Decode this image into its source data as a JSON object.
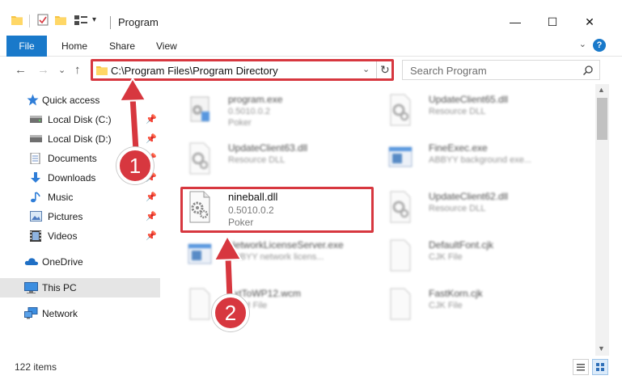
{
  "window": {
    "title": "Program",
    "minimize_glyph": "—",
    "maximize_glyph": "☐",
    "close_glyph": "✕"
  },
  "ribbon": {
    "file": "File",
    "tabs": [
      "Home",
      "Share",
      "View"
    ],
    "expand_glyph": "⌄",
    "help_glyph": "?"
  },
  "navigation": {
    "back_glyph": "←",
    "forward_glyph": "→",
    "recent_glyph": "⌄",
    "up_glyph": "↑",
    "address": "C:\\Program Files\\Program Directory",
    "address_dropdown_glyph": "⌄",
    "refresh_glyph": "↻",
    "search_placeholder": "Search Program"
  },
  "sidebar": {
    "items": [
      {
        "label": "Quick access",
        "icon": "star-icon",
        "pinned": false
      },
      {
        "label": "Local Disk (C:)",
        "icon": "drive-icon",
        "pinned": true
      },
      {
        "label": "Local Disk (D:)",
        "icon": "drive-icon",
        "pinned": true
      },
      {
        "label": "Documents",
        "icon": "documents-icon",
        "pinned": true
      },
      {
        "label": "Downloads",
        "icon": "download-icon",
        "pinned": true
      },
      {
        "label": "Music",
        "icon": "music-icon",
        "pinned": true
      },
      {
        "label": "Pictures",
        "icon": "pictures-icon",
        "pinned": true
      },
      {
        "label": "Videos",
        "icon": "videos-icon",
        "pinned": true
      },
      {
        "label": "OneDrive",
        "icon": "cloud-icon",
        "pinned": false
      },
      {
        "label": "This PC",
        "icon": "computer-icon",
        "pinned": false,
        "selected": true
      },
      {
        "label": "Network",
        "icon": "network-icon",
        "pinned": false
      }
    ],
    "pin_glyph": "📌"
  },
  "files": [
    {
      "name": "program.exe",
      "sub1": "0.5010.0.2",
      "sub2": "Poker",
      "icon": "exe-gear-icon"
    },
    {
      "name": "UpdateClient65.dll",
      "sub1": "Resource DLL",
      "sub2": "",
      "icon": "dll-icon"
    },
    {
      "name": "UpdateClient63.dll",
      "sub1": "Resource DLL",
      "sub2": "",
      "icon": "dll-icon"
    },
    {
      "name": "FineExec.exe",
      "sub1": "ABBYY background exe...",
      "sub2": "",
      "icon": "exe-window-icon"
    },
    {
      "name": "nineball.dll",
      "sub1": "0.5010.0.2",
      "sub2": "Poker",
      "icon": "dll-icon"
    },
    {
      "name": "UpdateClient62.dll",
      "sub1": "Resource DLL",
      "sub2": "",
      "icon": "dll-icon"
    },
    {
      "name": "NetworkLicenseServer.exe",
      "sub1": "ABBYY network licens...",
      "sub2": "",
      "icon": "exe-window-icon"
    },
    {
      "name": "DefaultFont.cjk",
      "sub1": "CJK File",
      "sub2": "",
      "icon": "blank-file-icon"
    },
    {
      "name": "TxtToWP12.wcm",
      "sub1": "WCM File",
      "sub2": "",
      "icon": "blank-file-icon"
    },
    {
      "name": "FastKorn.cjk",
      "sub1": "CJK File",
      "sub2": "",
      "icon": "blank-file-icon"
    }
  ],
  "status": {
    "item_count": "122 items"
  },
  "callouts": [
    "1",
    "2"
  ],
  "colors": {
    "accent": "#1979ca",
    "highlight": "#d7373f",
    "selection": "#e5e5e5"
  }
}
